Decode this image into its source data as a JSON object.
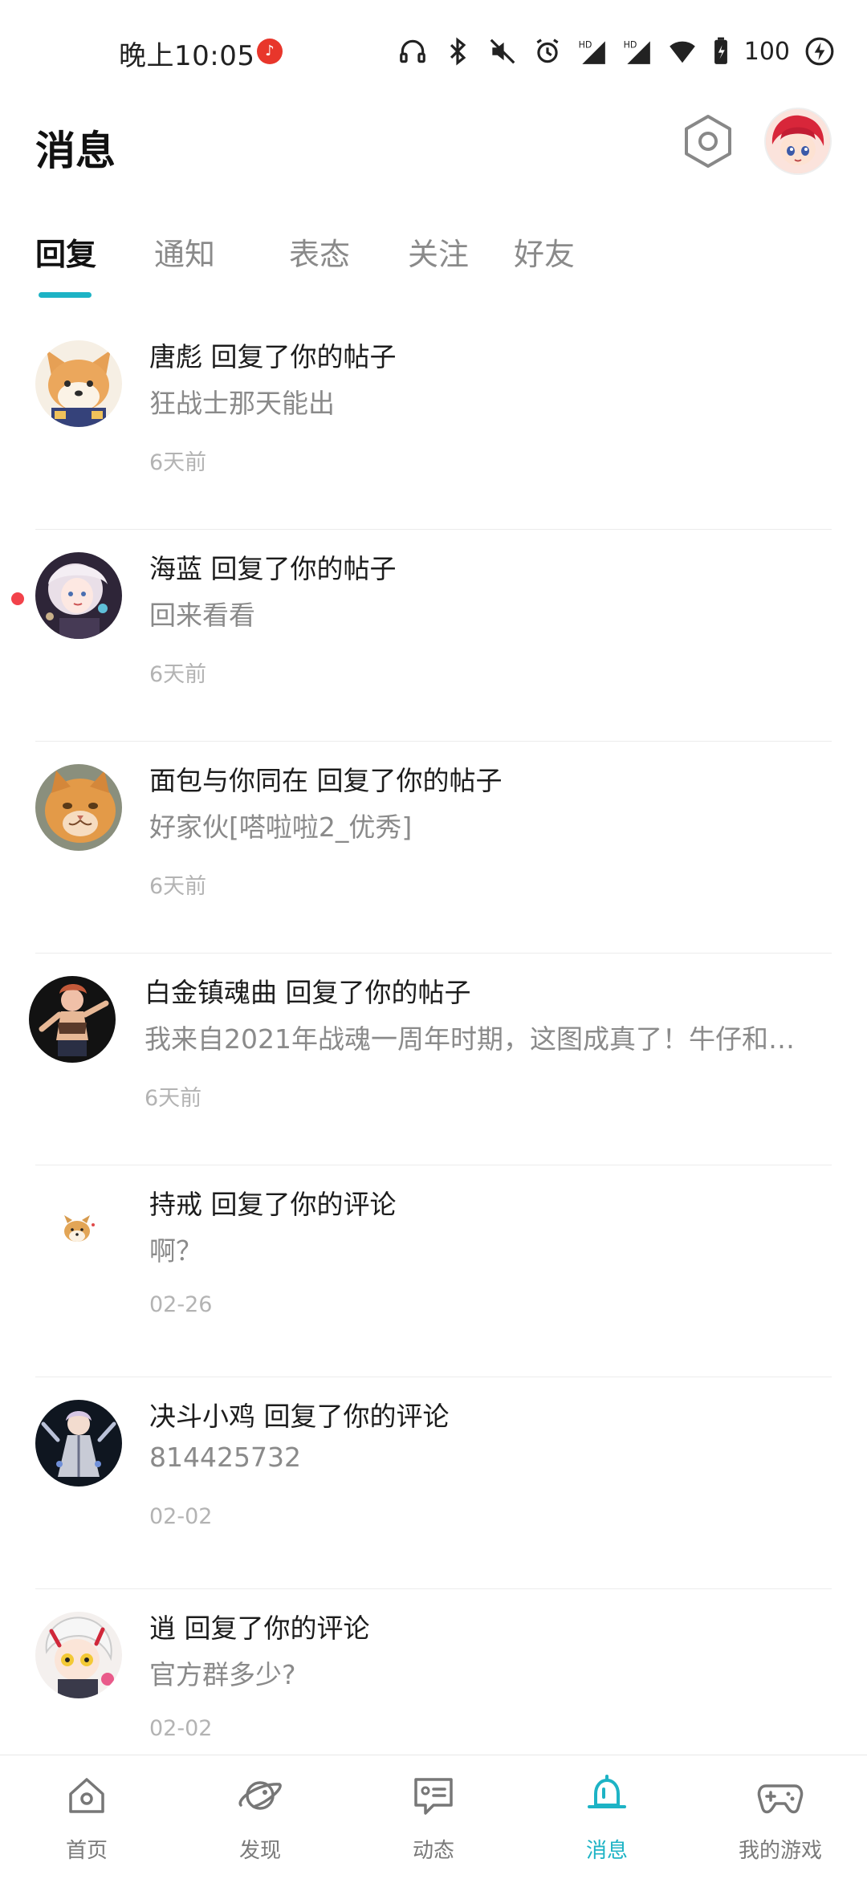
{
  "status_bar": {
    "time": "晚上10:05",
    "netease_icon": "netease-music-icon",
    "battery": "100",
    "icons": [
      "headphones-icon",
      "bluetooth-icon",
      "mute-icon",
      "alarm-icon",
      "hd-signal-icon",
      "hd-signal-icon",
      "wifi-icon",
      "battery-icon",
      "charging-icon"
    ]
  },
  "header": {
    "title": "消息",
    "settings_icon": "settings-icon",
    "avatar_icon": "user-avatar"
  },
  "tabs": [
    {
      "label": "回复",
      "active": true
    },
    {
      "label": "通知",
      "active": false
    },
    {
      "label": "表态",
      "active": false
    },
    {
      "label": "关注",
      "active": false
    },
    {
      "label": "好友",
      "active": false
    }
  ],
  "messages": [
    {
      "user": "唐彪",
      "action": "回复了你的帖子",
      "title": "唐彪 回复了你的帖子",
      "content": "狂战士那天能出",
      "time": "6天前",
      "unread": false
    },
    {
      "user": "海蓝",
      "action": "回复了你的帖子",
      "title": "海蓝 回复了你的帖子",
      "content": "回来看看",
      "time": "6天前",
      "unread": true
    },
    {
      "user": "面包与你同在",
      "action": "回复了你的帖子",
      "title": "面包与你同在 回复了你的帖子",
      "content": "好家伙[嗒啦啦2_优秀]",
      "time": "6天前",
      "unread": false
    },
    {
      "user": "白金镇魂曲",
      "action": "回复了你的帖子",
      "title": "白金镇魂曲 回复了你的帖子",
      "content": "我来自2021年战魂一周年时期，这图成真了！牛仔和…",
      "time": "6天前",
      "unread": false
    },
    {
      "user": "持戒",
      "action": "回复了你的评论",
      "title": "持戒 回复了你的评论",
      "content": "啊？",
      "time": "02-26",
      "unread": false
    },
    {
      "user": "决斗小鸡",
      "action": "回复了你的评论",
      "title": "决斗小鸡 回复了你的评论",
      "content": "814425732",
      "time": "02-02",
      "unread": false
    },
    {
      "user": "逍",
      "action": "回复了你的评论",
      "title": "逍 回复了你的评论",
      "content": "官方群多少?",
      "time": "02-02",
      "unread": false
    }
  ],
  "bottom_nav": [
    {
      "label": "首页",
      "icon": "home-icon",
      "active": false
    },
    {
      "label": "发现",
      "icon": "discover-planet-icon",
      "active": false
    },
    {
      "label": "动态",
      "icon": "feed-icon",
      "active": false
    },
    {
      "label": "消息",
      "icon": "bell-icon",
      "active": true
    },
    {
      "label": "我的游戏",
      "icon": "gamepad-icon",
      "active": false
    }
  ],
  "colors": {
    "accent": "#1db3c5",
    "unread": "#f2424a",
    "text_primary": "#1c1c1c",
    "text_secondary": "#8a8a8a",
    "text_time": "#b3b3b3"
  }
}
